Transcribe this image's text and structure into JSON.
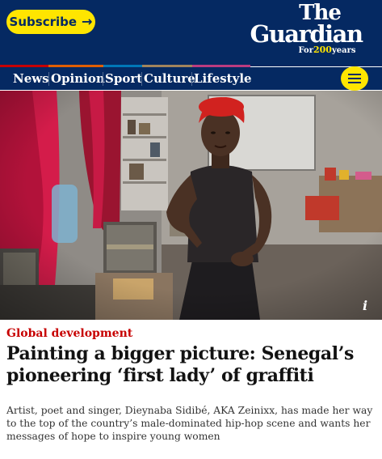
{
  "header": {
    "subscribe_label": "Subscribe",
    "subscribe_arrow": "→",
    "logo": {
      "line1": "The",
      "line2": "Guardian",
      "tagline_prefix": "For",
      "tagline_number": "200",
      "tagline_suffix": "years"
    }
  },
  "nav": {
    "items": [
      {
        "label": "News",
        "color": "#c70000"
      },
      {
        "label": "Opinion",
        "color": "#e05e00"
      },
      {
        "label": "Sport",
        "color": "#0077b6"
      },
      {
        "label": "Culture",
        "color": "#a1845c"
      },
      {
        "label": "Lifestyle",
        "color": "#bb3b80"
      }
    ],
    "menu_icon": "hamburger-menu-icon"
  },
  "article": {
    "image_info_icon": "i",
    "section": "Global development",
    "headline": "Painting a bigger picture: Senegal’s pioneering ‘first lady’ of graffiti",
    "standfirst": "Artist, poet and singer, Dieynaba Sidibé, AKA Zeinixx, has made her way to the top of the country’s male-dominated hip-hop scene and wants her messages of hope to inspire young women"
  },
  "colors": {
    "brand_blue": "#052962",
    "brand_yellow": "#ffe500",
    "section_red": "#c70000"
  }
}
